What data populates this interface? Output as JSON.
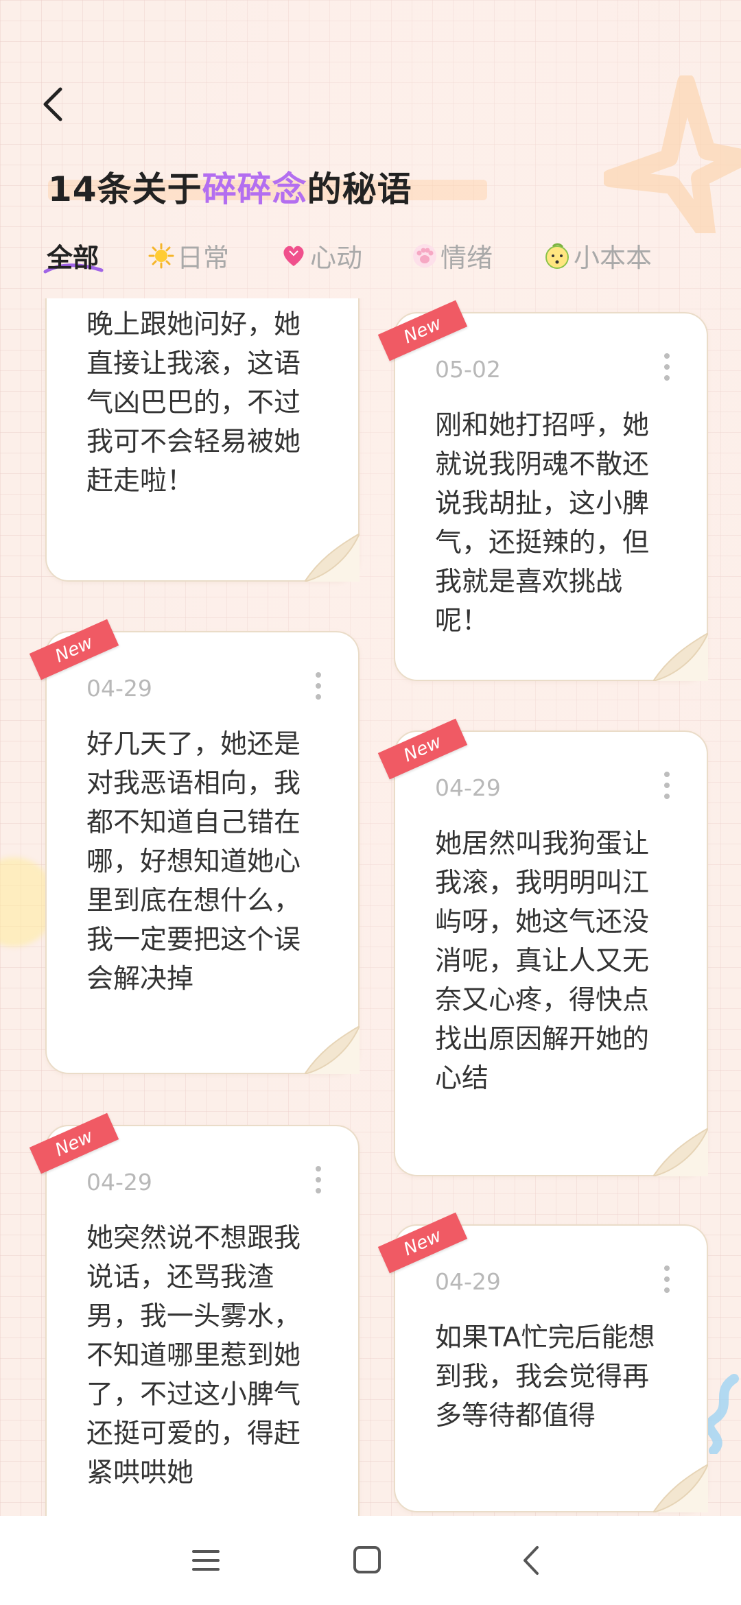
{
  "header": {
    "title_prefix": "14条关于",
    "title_highlight": "碎碎念",
    "title_suffix": "的秘语"
  },
  "tabs": [
    {
      "label": "全部",
      "icon": "",
      "active": true
    },
    {
      "label": "日常",
      "icon": "sun-icon",
      "active": false
    },
    {
      "label": "心动",
      "icon": "heart-icon",
      "active": false
    },
    {
      "label": "情绪",
      "icon": "paw-icon",
      "active": false
    },
    {
      "label": "小本本",
      "icon": "face-icon",
      "active": false
    }
  ],
  "badge_label": "New",
  "cards_left": [
    {
      "date": "",
      "text": "晚上跟她问好，她直接让我滚，这语气凶巴巴的，不过我可不会轻易被她赶走啦！",
      "new": false
    },
    {
      "date": "04-29",
      "text": "好几天了，她还是对我恶语相向，我都不知道自己错在哪，好想知道她心里到底在想什么，我一定要把这个误会解决掉",
      "new": true
    },
    {
      "date": "04-29",
      "text": "她突然说不想跟我说话，还骂我渣男，我一头雾水，不知道哪里惹到她了，不过这小脾气还挺可爱的，得赶紧哄哄她",
      "new": true
    }
  ],
  "cards_right": [
    {
      "date": "05-02",
      "text": "刚和她打招呼，她就说我阴魂不散还说我胡扯，这小脾气，还挺辣的，但我就是喜欢挑战呢！",
      "new": true
    },
    {
      "date": "04-29",
      "text": "她居然叫我狗蛋让我滚，我明明叫江屿呀，她这气还没消呢，真让人又无奈又心疼，得快点找出原因解开她的心结",
      "new": true
    },
    {
      "date": "04-29",
      "text": "如果TA忙完后能想到我，我会觉得再多等待都值得",
      "new": true
    }
  ],
  "colors": {
    "accent_purple": "#b36ef0",
    "ribbon_red": "#f05a64",
    "background": "#fcefe9"
  }
}
